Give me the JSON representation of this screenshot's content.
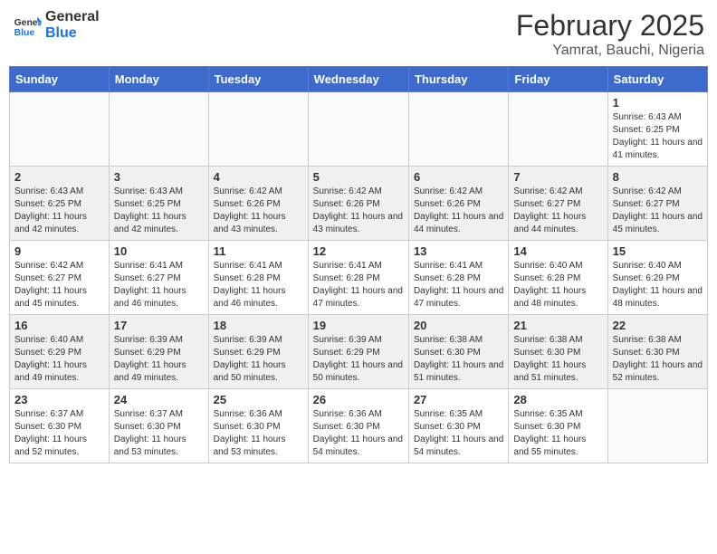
{
  "header": {
    "logo_line1": "General",
    "logo_line2": "Blue",
    "month": "February 2025",
    "location": "Yamrat, Bauchi, Nigeria"
  },
  "weekdays": [
    "Sunday",
    "Monday",
    "Tuesday",
    "Wednesday",
    "Thursday",
    "Friday",
    "Saturday"
  ],
  "weeks": [
    [
      {
        "day": "",
        "info": ""
      },
      {
        "day": "",
        "info": ""
      },
      {
        "day": "",
        "info": ""
      },
      {
        "day": "",
        "info": ""
      },
      {
        "day": "",
        "info": ""
      },
      {
        "day": "",
        "info": ""
      },
      {
        "day": "1",
        "info": "Sunrise: 6:43 AM\nSunset: 6:25 PM\nDaylight: 11 hours and 41 minutes."
      }
    ],
    [
      {
        "day": "2",
        "info": "Sunrise: 6:43 AM\nSunset: 6:25 PM\nDaylight: 11 hours and 42 minutes."
      },
      {
        "day": "3",
        "info": "Sunrise: 6:43 AM\nSunset: 6:25 PM\nDaylight: 11 hours and 42 minutes."
      },
      {
        "day": "4",
        "info": "Sunrise: 6:42 AM\nSunset: 6:26 PM\nDaylight: 11 hours and 43 minutes."
      },
      {
        "day": "5",
        "info": "Sunrise: 6:42 AM\nSunset: 6:26 PM\nDaylight: 11 hours and 43 minutes."
      },
      {
        "day": "6",
        "info": "Sunrise: 6:42 AM\nSunset: 6:26 PM\nDaylight: 11 hours and 44 minutes."
      },
      {
        "day": "7",
        "info": "Sunrise: 6:42 AM\nSunset: 6:27 PM\nDaylight: 11 hours and 44 minutes."
      },
      {
        "day": "8",
        "info": "Sunrise: 6:42 AM\nSunset: 6:27 PM\nDaylight: 11 hours and 45 minutes."
      }
    ],
    [
      {
        "day": "9",
        "info": "Sunrise: 6:42 AM\nSunset: 6:27 PM\nDaylight: 11 hours and 45 minutes."
      },
      {
        "day": "10",
        "info": "Sunrise: 6:41 AM\nSunset: 6:27 PM\nDaylight: 11 hours and 46 minutes."
      },
      {
        "day": "11",
        "info": "Sunrise: 6:41 AM\nSunset: 6:28 PM\nDaylight: 11 hours and 46 minutes."
      },
      {
        "day": "12",
        "info": "Sunrise: 6:41 AM\nSunset: 6:28 PM\nDaylight: 11 hours and 47 minutes."
      },
      {
        "day": "13",
        "info": "Sunrise: 6:41 AM\nSunset: 6:28 PM\nDaylight: 11 hours and 47 minutes."
      },
      {
        "day": "14",
        "info": "Sunrise: 6:40 AM\nSunset: 6:28 PM\nDaylight: 11 hours and 48 minutes."
      },
      {
        "day": "15",
        "info": "Sunrise: 6:40 AM\nSunset: 6:29 PM\nDaylight: 11 hours and 48 minutes."
      }
    ],
    [
      {
        "day": "16",
        "info": "Sunrise: 6:40 AM\nSunset: 6:29 PM\nDaylight: 11 hours and 49 minutes."
      },
      {
        "day": "17",
        "info": "Sunrise: 6:39 AM\nSunset: 6:29 PM\nDaylight: 11 hours and 49 minutes."
      },
      {
        "day": "18",
        "info": "Sunrise: 6:39 AM\nSunset: 6:29 PM\nDaylight: 11 hours and 50 minutes."
      },
      {
        "day": "19",
        "info": "Sunrise: 6:39 AM\nSunset: 6:29 PM\nDaylight: 11 hours and 50 minutes."
      },
      {
        "day": "20",
        "info": "Sunrise: 6:38 AM\nSunset: 6:30 PM\nDaylight: 11 hours and 51 minutes."
      },
      {
        "day": "21",
        "info": "Sunrise: 6:38 AM\nSunset: 6:30 PM\nDaylight: 11 hours and 51 minutes."
      },
      {
        "day": "22",
        "info": "Sunrise: 6:38 AM\nSunset: 6:30 PM\nDaylight: 11 hours and 52 minutes."
      }
    ],
    [
      {
        "day": "23",
        "info": "Sunrise: 6:37 AM\nSunset: 6:30 PM\nDaylight: 11 hours and 52 minutes."
      },
      {
        "day": "24",
        "info": "Sunrise: 6:37 AM\nSunset: 6:30 PM\nDaylight: 11 hours and 53 minutes."
      },
      {
        "day": "25",
        "info": "Sunrise: 6:36 AM\nSunset: 6:30 PM\nDaylight: 11 hours and 53 minutes."
      },
      {
        "day": "26",
        "info": "Sunrise: 6:36 AM\nSunset: 6:30 PM\nDaylight: 11 hours and 54 minutes."
      },
      {
        "day": "27",
        "info": "Sunrise: 6:35 AM\nSunset: 6:30 PM\nDaylight: 11 hours and 54 minutes."
      },
      {
        "day": "28",
        "info": "Sunrise: 6:35 AM\nSunset: 6:30 PM\nDaylight: 11 hours and 55 minutes."
      },
      {
        "day": "",
        "info": ""
      }
    ]
  ]
}
